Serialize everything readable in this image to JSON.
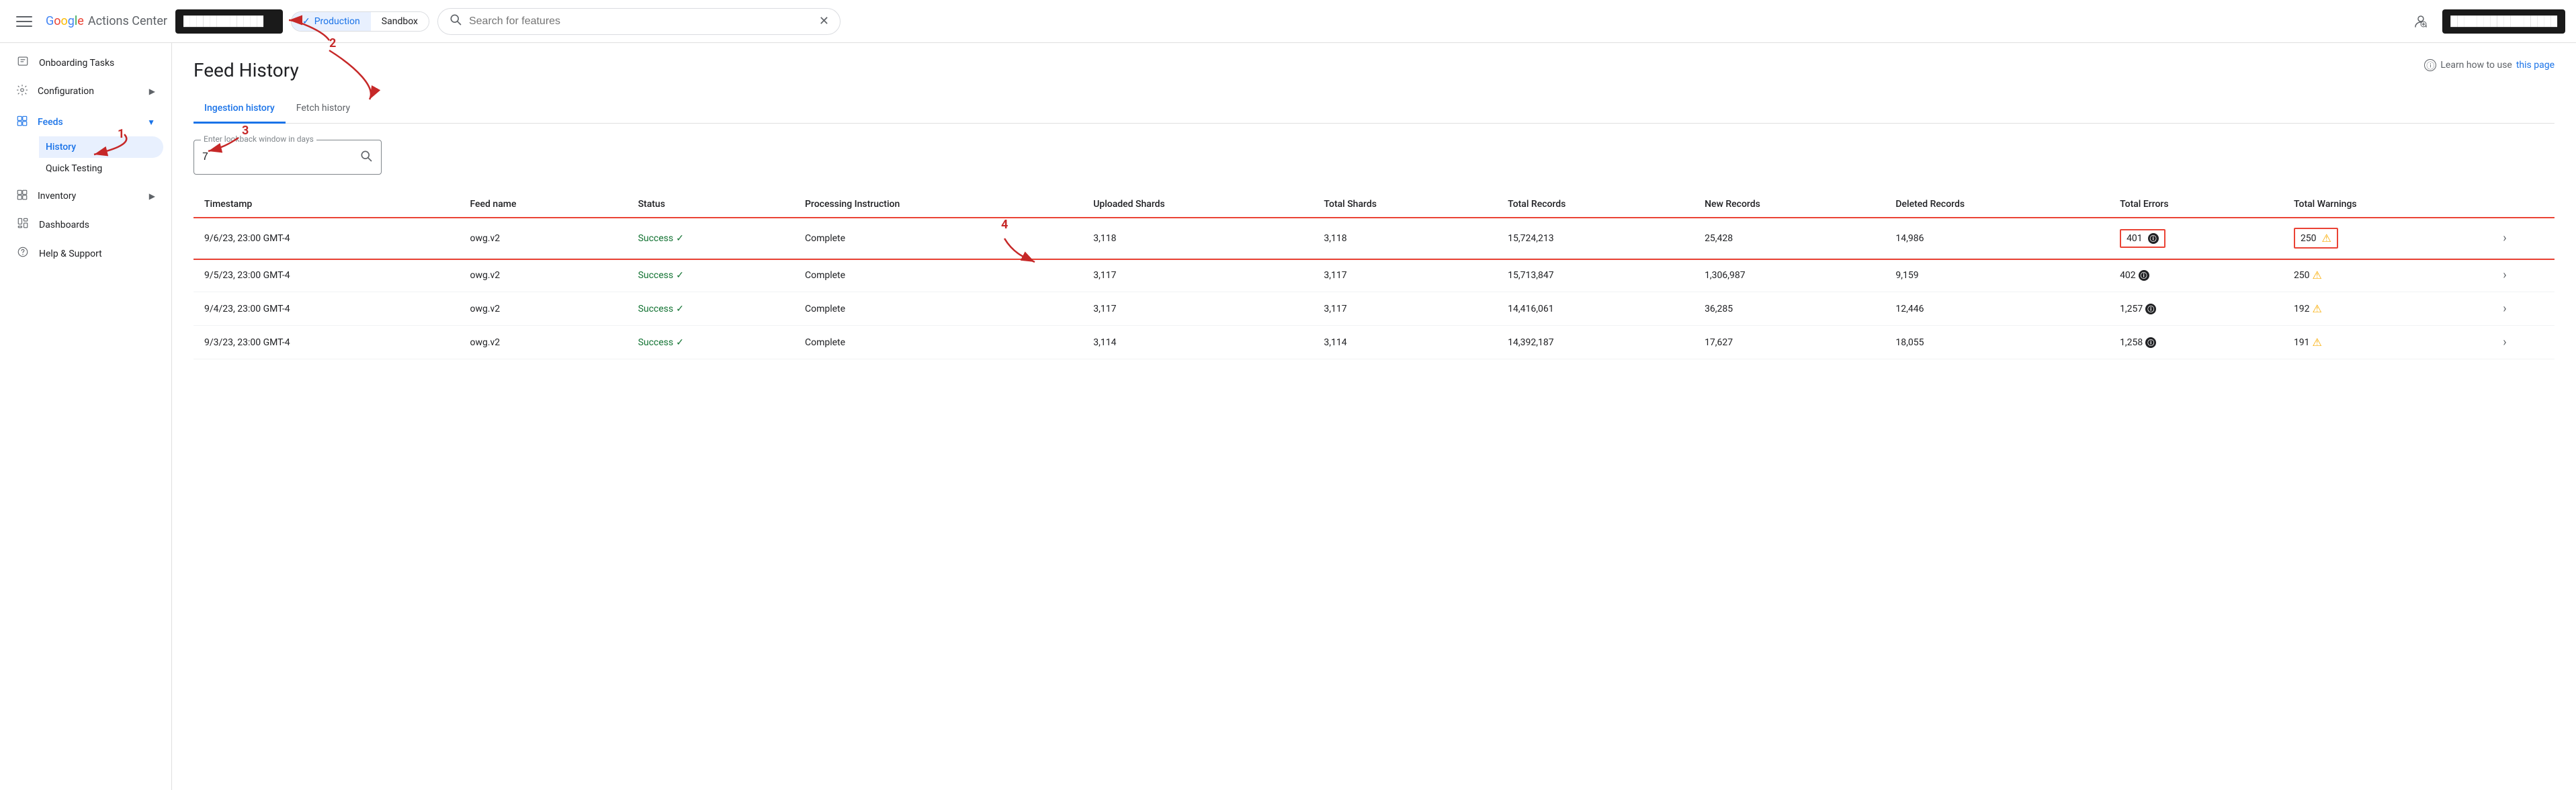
{
  "header": {
    "menu_icon": "☰",
    "logo_letters": [
      "G",
      "o",
      "o",
      "g",
      "l",
      "e"
    ],
    "logo_text": " Actions Center",
    "account_placeholder": "████████████",
    "env_tabs": [
      {
        "label": "Production",
        "active": true,
        "has_check": true
      },
      {
        "label": "Sandbox",
        "active": false,
        "has_check": false
      }
    ],
    "search_placeholder": "Search for features",
    "right_block": "████████████████"
  },
  "sidebar": {
    "items": [
      {
        "id": "onboarding",
        "label": "Onboarding Tasks",
        "icon": "☑",
        "active": false,
        "expandable": false
      },
      {
        "id": "configuration",
        "label": "Configuration",
        "icon": "⚙",
        "active": false,
        "expandable": true
      },
      {
        "id": "feeds",
        "label": "Feeds",
        "icon": "⊞",
        "active": true,
        "expandable": true,
        "children": [
          {
            "id": "history",
            "label": "History",
            "active": true
          },
          {
            "id": "quick-testing",
            "label": "Quick Testing",
            "active": false
          }
        ]
      },
      {
        "id": "inventory",
        "label": "Inventory",
        "icon": "⊞",
        "active": false,
        "expandable": true
      },
      {
        "id": "dashboards",
        "label": "Dashboards",
        "icon": "⊟",
        "active": false,
        "expandable": false
      },
      {
        "id": "help",
        "label": "Help & Support",
        "icon": "?",
        "active": false,
        "expandable": false
      }
    ]
  },
  "page": {
    "title": "Feed History",
    "help_text": "Learn how to use",
    "help_link": "this page"
  },
  "tabs": [
    {
      "label": "Ingestion history",
      "active": true
    },
    {
      "label": "Fetch history",
      "active": false
    }
  ],
  "lookback": {
    "label": "Enter lookback window in days",
    "value": "7"
  },
  "table": {
    "columns": [
      "Timestamp",
      "Feed name",
      "Status",
      "Processing Instruction",
      "Uploaded Shards",
      "Total Shards",
      "Total Records",
      "New Records",
      "Deleted Records",
      "Total Errors",
      "Total Warnings"
    ],
    "rows": [
      {
        "timestamp": "9/6/23, 23:00 GMT-4",
        "feed_name": "owg.v2",
        "status": "Success",
        "processing_instruction": "Complete",
        "uploaded_shards": "3,118",
        "total_shards": "3,118",
        "total_records": "15,724,213",
        "new_records": "25,428",
        "deleted_records": "14,986",
        "total_errors": "401",
        "total_warnings": "250",
        "highlighted": true
      },
      {
        "timestamp": "9/5/23, 23:00 GMT-4",
        "feed_name": "owg.v2",
        "status": "Success",
        "processing_instruction": "Complete",
        "uploaded_shards": "3,117",
        "total_shards": "3,117",
        "total_records": "15,713,847",
        "new_records": "1,306,987",
        "deleted_records": "9,159",
        "total_errors": "402",
        "total_warnings": "250",
        "highlighted": false
      },
      {
        "timestamp": "9/4/23, 23:00 GMT-4",
        "feed_name": "owg.v2",
        "status": "Success",
        "processing_instruction": "Complete",
        "uploaded_shards": "3,117",
        "total_shards": "3,117",
        "total_records": "14,416,061",
        "new_records": "36,285",
        "deleted_records": "12,446",
        "total_errors": "1,257",
        "total_warnings": "192",
        "highlighted": false
      },
      {
        "timestamp": "9/3/23, 23:00 GMT-4",
        "feed_name": "owg.v2",
        "status": "Success",
        "processing_instruction": "Complete",
        "uploaded_shards": "3,114",
        "total_shards": "3,114",
        "total_records": "14,392,187",
        "new_records": "17,627",
        "deleted_records": "18,055",
        "total_errors": "1,258",
        "total_warnings": "191",
        "highlighted": false
      }
    ]
  },
  "annotations": {
    "labels": [
      "1",
      "2",
      "3",
      "4"
    ]
  }
}
